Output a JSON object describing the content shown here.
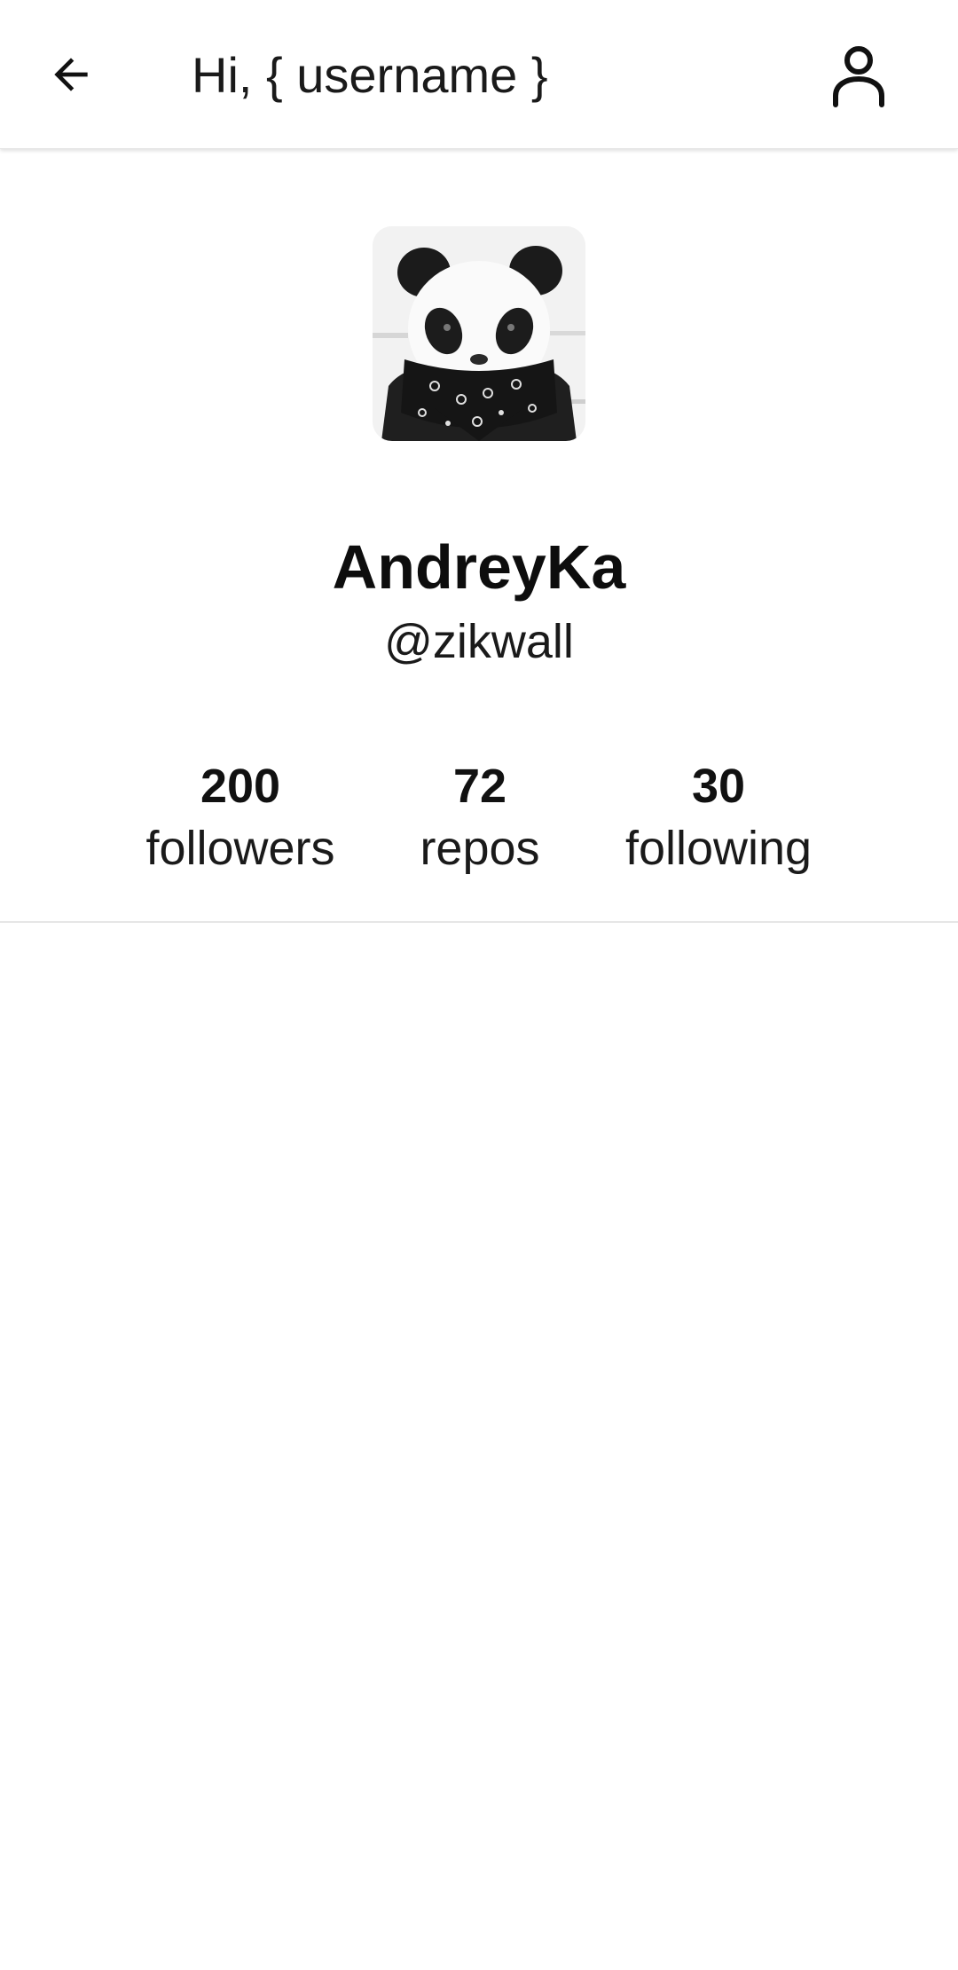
{
  "app_bar": {
    "title": "Hi, { username }",
    "back_icon": "arrow-back-icon",
    "account_icon": "person-icon"
  },
  "profile": {
    "avatar_description": "panda-with-bandana-avatar",
    "name": "AndreyKa",
    "handle": "@zikwall"
  },
  "stats": {
    "followers": {
      "value": "200",
      "label": "followers"
    },
    "repos": {
      "value": "72",
      "label": "repos"
    },
    "following": {
      "value": "30",
      "label": "following"
    }
  },
  "colors": {
    "background": "#ffffff",
    "text": "#111111",
    "divider": "#e6e6e6"
  }
}
